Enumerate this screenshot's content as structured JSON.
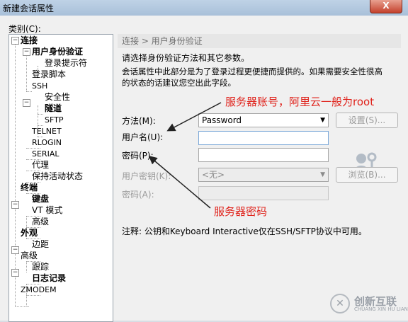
{
  "window": {
    "title": "新建会话属性",
    "close_label": "X"
  },
  "category_label": "类别(C):",
  "tree": [
    {
      "id": "conn",
      "label": "连接"
    },
    {
      "id": "auth",
      "label": "用户身份验证"
    },
    {
      "id": "prompt",
      "label": "登录提示符"
    },
    {
      "id": "script",
      "label": "登录脚本"
    },
    {
      "id": "ssh",
      "label": "SSH"
    },
    {
      "id": "security",
      "label": "安全性"
    },
    {
      "id": "tunnel",
      "label": "隧道"
    },
    {
      "id": "sftp",
      "label": "SFTP"
    },
    {
      "id": "telnet",
      "label": "TELNET"
    },
    {
      "id": "rlogin",
      "label": "RLOGIN"
    },
    {
      "id": "serial",
      "label": "SERIAL"
    },
    {
      "id": "proxy",
      "label": "代理"
    },
    {
      "id": "keepalive",
      "label": "保持活动状态"
    },
    {
      "id": "terminal",
      "label": "终端"
    },
    {
      "id": "keyboard",
      "label": "键盘"
    },
    {
      "id": "vt",
      "label": "VT 模式"
    },
    {
      "id": "term_adv",
      "label": "高级"
    },
    {
      "id": "appearance",
      "label": "外观"
    },
    {
      "id": "margin",
      "label": "边距"
    },
    {
      "id": "advanced",
      "label": "高级"
    },
    {
      "id": "trace",
      "label": "跟踪"
    },
    {
      "id": "log",
      "label": "日志记录"
    },
    {
      "id": "zmodem",
      "label": "ZMODEM"
    }
  ],
  "panel": {
    "breadcrumb": "连接 > 用户身份验证",
    "desc_line1": "请选择身份验证方法和其它参数。",
    "desc_line2": "会话属性中此部分是为了登录过程更便捷而提供的。如果需要安全性很高",
    "desc_line3": "的状态的话建议您空出此字段。",
    "method_label": "方法(M):",
    "method_value": "Password",
    "settings_button": "设置(S)...",
    "username_label": "用户名(U):",
    "username_value": "",
    "password_label": "密码(P):",
    "password_value": "",
    "userkey_label": "用户密钥(K):",
    "userkey_value": "<无>",
    "browse_button": "浏览(B)...",
    "passphrase_label": "密码(A):",
    "note": "注释: 公钥和Keyboard Interactive仅在SSH/SFTP协议中可用。"
  },
  "annotations": {
    "username_note": "服务器账号，阿里云一般为root",
    "password_note": "服务器密码",
    "color": "#e0231c"
  },
  "watermark": {
    "logo": "✕",
    "name": "创新互联",
    "sub": "CHUANG XIN HU LIAN"
  }
}
